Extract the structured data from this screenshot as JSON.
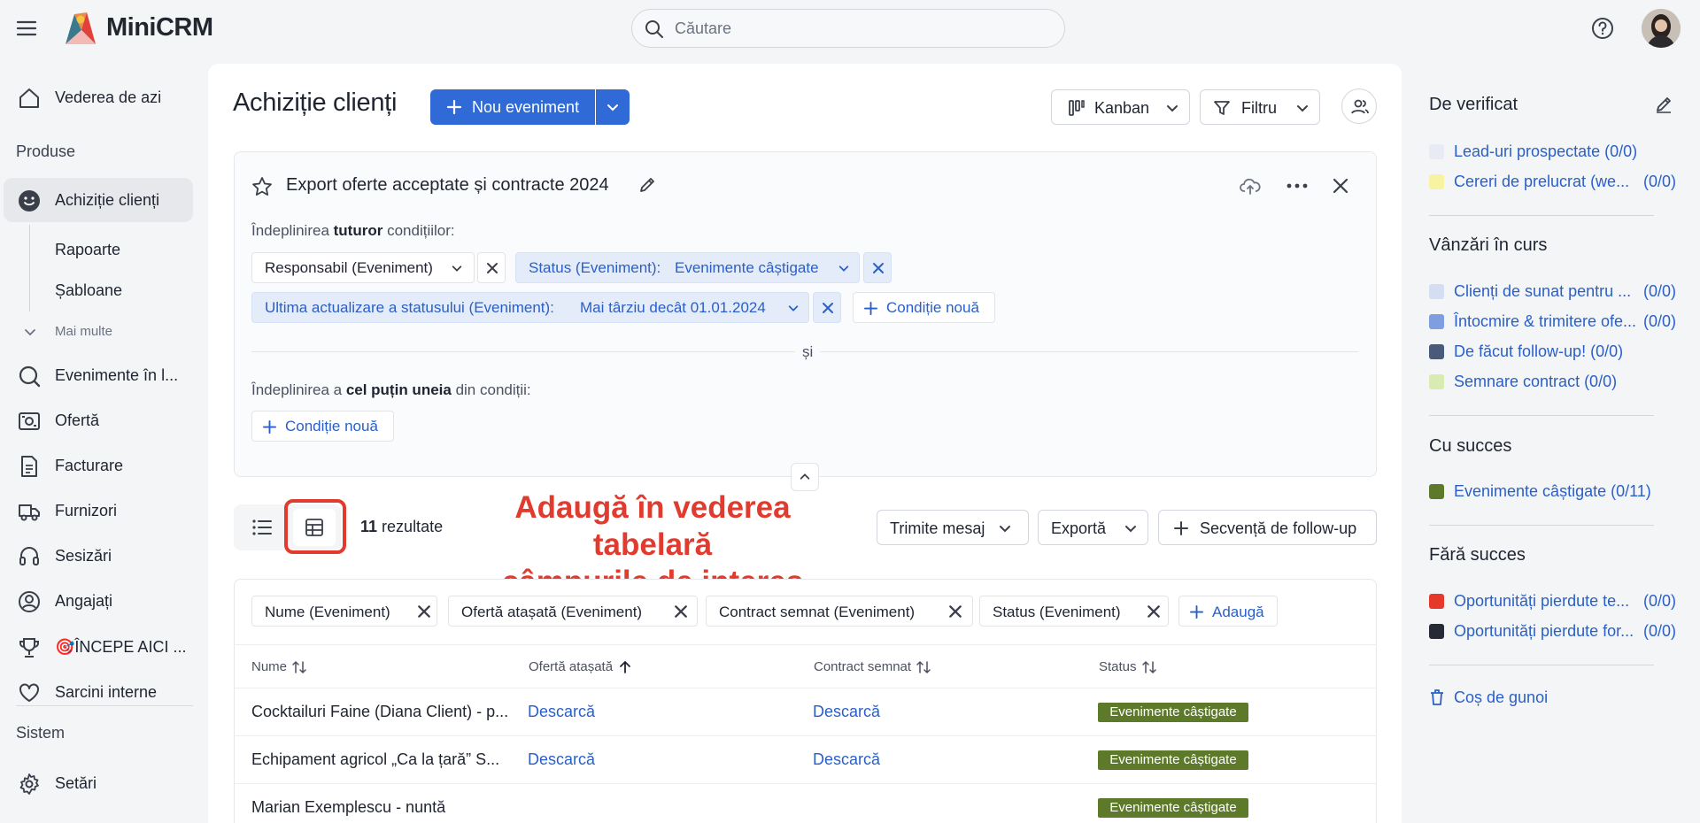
{
  "app": {
    "brand": "MiniCRM",
    "search_placeholder": "Căutare"
  },
  "sidebar": {
    "items": [
      {
        "label": "Vederea de azi"
      },
      {
        "label": "Achiziție clienți"
      },
      {
        "label": "Evenimente în l..."
      },
      {
        "label": "Ofertă"
      },
      {
        "label": "Facturare"
      },
      {
        "label": "Furnizori"
      },
      {
        "label": "Sesizări"
      },
      {
        "label": "Angajați"
      },
      {
        "label": "🎯ÎNCEPE AICI ..."
      },
      {
        "label": "Sarcini interne"
      },
      {
        "label": "Setări"
      }
    ],
    "section_products": "Produse",
    "section_system": "Sistem",
    "sub_items": [
      {
        "label": "Rapoarte"
      },
      {
        "label": "Șabloane"
      }
    ],
    "more": "Mai multe"
  },
  "header": {
    "title": "Achiziție clienți",
    "new_event": "Nou eveniment",
    "view": "Kanban",
    "filter": "Filtru"
  },
  "filter": {
    "name": "Export oferte acceptate și contracte 2024",
    "all_prefix": "Îndeplinirea",
    "all_bold": "tuturor",
    "all_suffix": "condițiilor:",
    "chips_all": [
      {
        "label": "Responsabil (Eveniment)",
        "value": ""
      },
      {
        "label": "Status (Eveniment):",
        "value": "Evenimente câștigate"
      },
      {
        "label": "Ultima actualizare a statusului (Eveniment):",
        "value": "Mai târziu decât 01.01.2024"
      }
    ],
    "new_condition": "Condiție nouă",
    "and": "și",
    "any_prefix": "Îndeplinirea a",
    "any_bold": "cel puțin uneia",
    "any_suffix": "din condiții:"
  },
  "results": {
    "count": "11",
    "label": "rezultate",
    "send_message": "Trimite mesaj",
    "export": "Exportă",
    "follow_up": "Secvență de follow-up",
    "columns_chips": [
      "Nume (Eveniment)",
      "Ofertă atașată (Eveniment)",
      "Contract semnat (Eveniment)",
      "Status (Eveniment)"
    ],
    "add": "Adaugă"
  },
  "table": {
    "headers": [
      "Nume",
      "Ofertă atașată",
      "Contract semnat",
      "Status"
    ],
    "rows": [
      {
        "name": "Cocktailuri Faine (Diana Client) - p...",
        "offer": "Descarcă",
        "contract": "Descarcă",
        "status": "Evenimente câștigate"
      },
      {
        "name": "Echipament agricol „Ca la țară” S...",
        "offer": "Descarcă",
        "contract": "Descarcă",
        "status": "Evenimente câștigate"
      },
      {
        "name": "Marian Exemplescu - nuntă",
        "offer": "",
        "contract": "",
        "status": "Evenimente câștigate"
      }
    ]
  },
  "annotation": {
    "line1": "Adaugă în vederea tabelară",
    "line2": "câmpurile de interes"
  },
  "right_panel": {
    "sections": [
      {
        "title": "De verificat",
        "items": [
          {
            "name": "Lead-uri prospectate (0/0)",
            "count": "",
            "color": "#e8ebf3"
          },
          {
            "name": "Cereri de prelucrat (we...",
            "count": "(0/0)",
            "color": "#f7f3a0"
          }
        ]
      },
      {
        "title": "Vânzări în curs",
        "items": [
          {
            "name": "Clienți de sunat pentru ...",
            "count": "(0/0)",
            "color": "#d4ddf1"
          },
          {
            "name": "Întocmire & trimitere ofe...",
            "count": "(0/0)",
            "color": "#7f9ee0"
          },
          {
            "name": "De făcut follow-up! (0/0)",
            "count": "",
            "color": "#4a5a7a"
          },
          {
            "name": "Semnare contract (0/0)",
            "count": "",
            "color": "#d8ebb1"
          }
        ]
      },
      {
        "title": "Cu succes",
        "items": [
          {
            "name": "Evenimente câștigate (0/11)",
            "count": "",
            "color": "#5d7a2a"
          }
        ]
      },
      {
        "title": "Fără succes",
        "items": [
          {
            "name": "Oportunități pierdute te...",
            "count": "(0/0)",
            "color": "#e7382c"
          },
          {
            "name": "Oportunități pierdute for...",
            "count": "(0/0)",
            "color": "#252a35"
          }
        ]
      }
    ],
    "trash": "Coș de gunoi"
  }
}
